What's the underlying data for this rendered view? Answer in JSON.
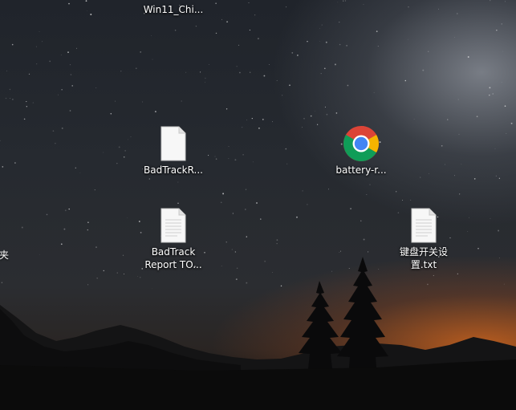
{
  "desktop": {
    "icons": [
      {
        "name": "Win11_Chi...",
        "kind": "folder-partial"
      },
      {
        "name": "BadTrackR...",
        "kind": "text-file"
      },
      {
        "name": "battery-r...",
        "kind": "chrome-html"
      },
      {
        "name": "BadTrack\nReport TO...",
        "kind": "text-file"
      },
      {
        "name": "键盘开关设\n置.txt",
        "kind": "text-file"
      }
    ],
    "edge_partial_label": "夹"
  },
  "colors": {
    "chrome_red": "#DB4437",
    "chrome_yellow": "#F4B400",
    "chrome_green": "#0F9D58",
    "chrome_blue": "#4285F4",
    "horizon_glow": "#E07020"
  }
}
